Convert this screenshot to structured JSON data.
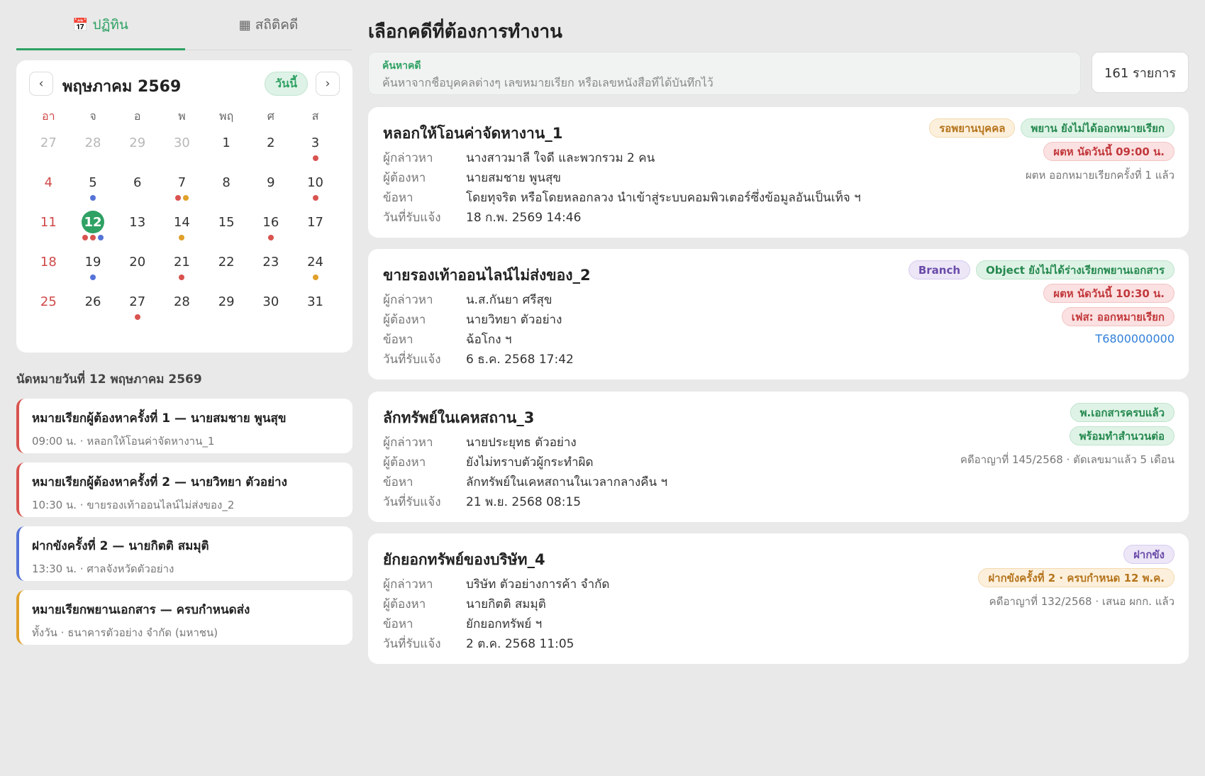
{
  "tabs": [
    {
      "icon": "📅",
      "label": "ปฏิทิน",
      "active": true
    },
    {
      "icon": "▦",
      "label": "สถิติคดี",
      "active": false
    }
  ],
  "calendar": {
    "prev_label": "‹",
    "next_label": "›",
    "month_title": "พฤษภาคม 2569",
    "today_label": "วันนี้",
    "weekdays": [
      "อา",
      "จ",
      "อ",
      "พ",
      "พฤ",
      "ศ",
      "ส"
    ],
    "dot_colors": {
      "red": "#d9534f",
      "blue": "#5573d8",
      "amber": "#e0a02a"
    },
    "weeks": [
      [
        {
          "d": "27",
          "muted": true
        },
        {
          "d": "28",
          "muted": true
        },
        {
          "d": "29",
          "muted": true
        },
        {
          "d": "30",
          "muted": true
        },
        {
          "d": "1"
        },
        {
          "d": "2"
        },
        {
          "d": "3",
          "dots": [
            "red"
          ]
        }
      ],
      [
        {
          "d": "4"
        },
        {
          "d": "5",
          "dots": [
            "blue"
          ]
        },
        {
          "d": "6"
        },
        {
          "d": "7",
          "dots": [
            "red",
            "amber"
          ]
        },
        {
          "d": "8"
        },
        {
          "d": "9"
        },
        {
          "d": "10",
          "dots": [
            "red"
          ]
        }
      ],
      [
        {
          "d": "11"
        },
        {
          "d": "12",
          "today": true,
          "dots": [
            "red",
            "red",
            "blue"
          ]
        },
        {
          "d": "13"
        },
        {
          "d": "14",
          "dots": [
            "amber"
          ]
        },
        {
          "d": "15"
        },
        {
          "d": "16",
          "dots": [
            "red"
          ]
        },
        {
          "d": "17"
        }
      ],
      [
        {
          "d": "18"
        },
        {
          "d": "19",
          "dots": [
            "blue"
          ]
        },
        {
          "d": "20"
        },
        {
          "d": "21",
          "dots": [
            "red"
          ]
        },
        {
          "d": "22"
        },
        {
          "d": "23"
        },
        {
          "d": "24",
          "dots": [
            "amber"
          ]
        }
      ],
      [
        {
          "d": "25"
        },
        {
          "d": "26"
        },
        {
          "d": "27",
          "dots": [
            "red"
          ]
        },
        {
          "d": "28"
        },
        {
          "d": "29"
        },
        {
          "d": "30"
        },
        {
          "d": "31"
        }
      ]
    ]
  },
  "appointments": {
    "heading": "นัดหมายวันที่ 12 พฤษภาคม 2569",
    "items": [
      {
        "title": "หมายเรียกผู้ต้องหาครั้งที่ 1 — นายสมชาย พูนสุข",
        "sub": "09:00 น. · หลอกให้โอนค่าจัดหางาน_1",
        "color": "#d9534f"
      },
      {
        "title": "หมายเรียกผู้ต้องหาครั้งที่ 2 — นายวิทยา ตัวอย่าง",
        "sub": "10:30 น. · ขายรองเท้าออนไลน์ไม่ส่งของ_2",
        "color": "#d9534f"
      },
      {
        "title": "ฝากขังครั้งที่ 2 — นายกิตติ สมมุติ",
        "sub": "13:30 น. · ศาลจังหวัดตัวอย่าง",
        "color": "#5573d8"
      },
      {
        "title": "หมายเรียกพยานเอกสาร — ครบกำหนดส่ง",
        "sub": "ทั้งวัน · ธนาคารตัวอย่าง จำกัด (มหาชน)",
        "color": "#e0a02a"
      }
    ]
  },
  "main": {
    "title": "เลือกคดีที่ต้องการทำงาน",
    "search_label": "ค้นหาคดี",
    "search_placeholder": "ค้นหาจากชื่อบุคคลต่างๆ เลขหมายเรียก หรือเลขหนังสือที่ได้บันทึกไว้",
    "count_label": "161 รายการ",
    "field_labels": {
      "accuser": "ผู้กล่าวหา",
      "suspect": "ผู้ต้องหา",
      "charge": "ข้อหา",
      "reported": "วันที่รับแจ้ง"
    }
  },
  "cases": [
    {
      "title": "หลอกให้โอนค่าจัดหางาน_1",
      "accuser": "นางสาวมาลี ใจดี และพวกรวม 2 คน",
      "suspect": "นายสมชาย พูนสุข",
      "charge": "โดยทุจริต หรือโดยหลอกลวง นำเข้าสู่ระบบคอมพิวเตอร์ซึ่งข้อมูลอันเป็นเท็จ ฯ",
      "reported": "18 ก.พ. 2569 14:46",
      "badge_rows": [
        [
          {
            "text": "รอพยานบุคคล",
            "style": "amber"
          },
          {
            "text": "พยาน ยังไม่ได้ออกหมายเรียก",
            "style": "green"
          }
        ],
        [
          {
            "text": "ผตห นัดวันนี้ 09:00 น.",
            "style": "red"
          }
        ]
      ],
      "meta": "ผตห ออกหมายเรียกครั้งที่ 1 แล้ว",
      "link": ""
    },
    {
      "title": "ขายรองเท้าออนไลน์ไม่ส่งของ_2",
      "accuser": "น.ส.กันยา ศรีสุข",
      "suspect": "นายวิทยา ตัวอย่าง",
      "charge": "ฉ้อโกง ฯ",
      "reported": "6 ธ.ค. 2568 17:42",
      "badge_rows": [
        [
          {
            "text": "Branch",
            "style": "purple"
          },
          {
            "text": "Object ยังไม่ได้ร่างเรียกพยานเอกสาร",
            "style": "green"
          }
        ],
        [
          {
            "text": "ผตห นัดวันนี้ 10:30 น.",
            "style": "red"
          }
        ],
        [
          {
            "text": "เฟส: ออกหมายเรียก",
            "style": "red"
          }
        ]
      ],
      "meta": "",
      "link": "T6800000000"
    },
    {
      "title": "ลักทรัพย์ในเคหสถาน_3",
      "accuser": "นายประยุทธ ตัวอย่าง",
      "suspect": "ยังไม่ทราบตัวผู้กระทำผิด",
      "charge": "ลักทรัพย์ในเคหสถานในเวลากลางคืน ฯ",
      "reported": "21 พ.ย. 2568 08:15",
      "badge_rows": [
        [
          {
            "text": "พ.เอกสารครบแล้ว",
            "style": "green"
          }
        ],
        [
          {
            "text": "พร้อมทำสำนวนต่อ",
            "style": "green"
          }
        ]
      ],
      "meta": "คดีอาญาที่ 145/2568 · ตัดเลขมาแล้ว 5 เดือน",
      "link": ""
    },
    {
      "title": "ยักยอกทรัพย์ของบริษัท_4",
      "accuser": "บริษัท ตัวอย่างการค้า จำกัด",
      "suspect": "นายกิตติ สมมุติ",
      "charge": "ยักยอกทรัพย์ ฯ",
      "reported": "2 ต.ค. 2568 11:05",
      "badge_rows": [
        [
          {
            "text": "ฝากขัง",
            "style": "purple"
          }
        ],
        [
          {
            "text": "ฝากขังครั้งที่ 2 · ครบกำหนด 12 พ.ค.",
            "style": "amber"
          }
        ]
      ],
      "meta": "คดีอาญาที่ 132/2568 · เสนอ ผกก. แล้ว",
      "link": ""
    }
  ]
}
